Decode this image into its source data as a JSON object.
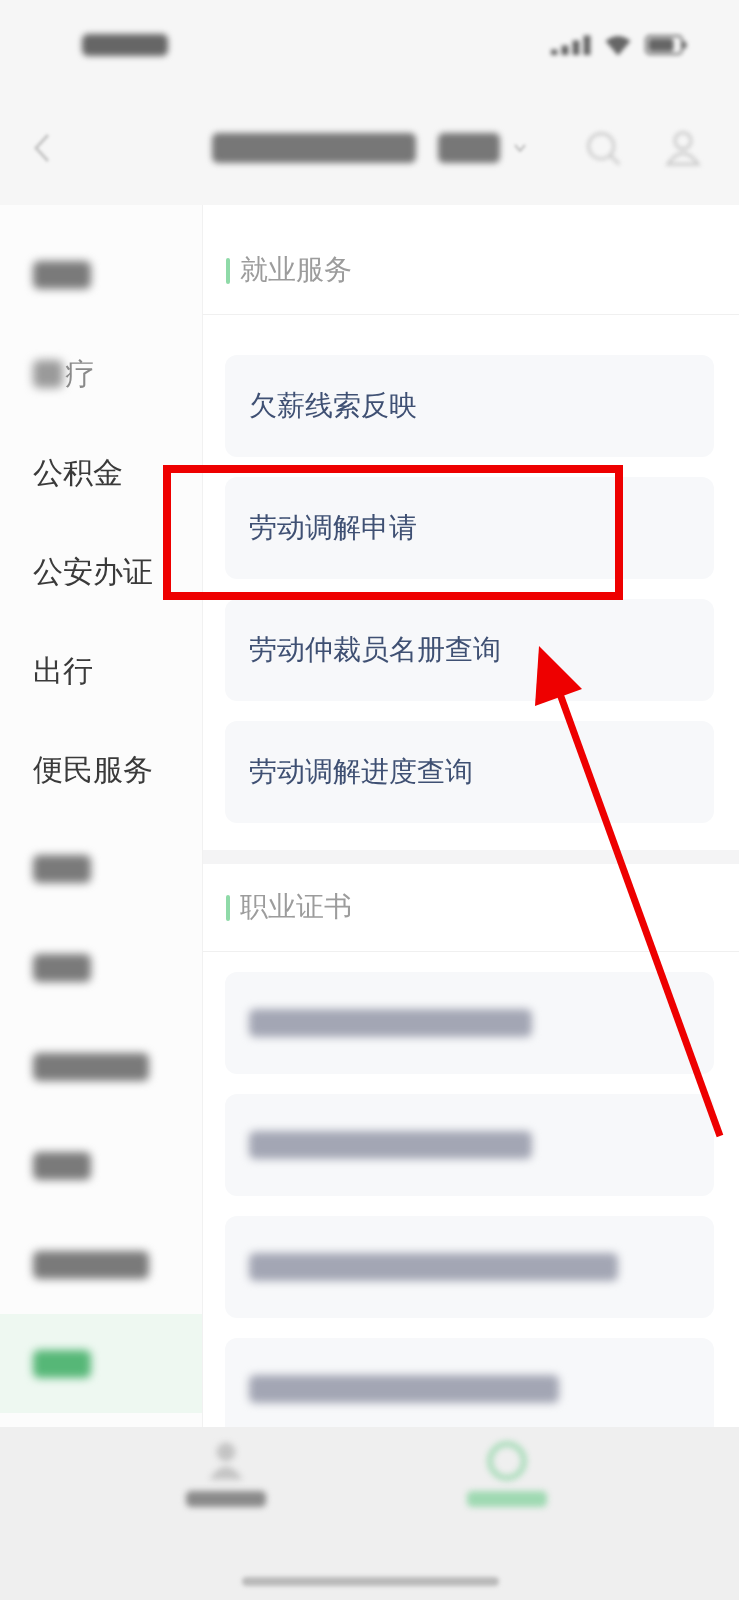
{
  "sidebar": {
    "items": [
      {
        "kind": "blurred",
        "selected": false
      },
      {
        "kind": "partial",
        "label": "疗",
        "selected": false
      },
      {
        "kind": "text",
        "label": "公积金",
        "selected": false
      },
      {
        "kind": "text",
        "label": "公安办证",
        "selected": false
      },
      {
        "kind": "text",
        "label": "出行",
        "selected": false
      },
      {
        "kind": "text",
        "label": "便民服务",
        "selected": false
      },
      {
        "kind": "blurred",
        "selected": false
      },
      {
        "kind": "blurred",
        "selected": false
      },
      {
        "kind": "blurred",
        "selected": false
      },
      {
        "kind": "blurred",
        "selected": false
      },
      {
        "kind": "blurred",
        "selected": false
      },
      {
        "kind": "blurred",
        "selected": true
      }
    ]
  },
  "sections": [
    {
      "title": "就业服务",
      "items": [
        {
          "kind": "text",
          "label": "欠薪线索反映",
          "highlighted": false
        },
        {
          "kind": "text",
          "label": "劳动调解申请",
          "highlighted": true
        },
        {
          "kind": "text",
          "label": "劳动仲裁员名册查询",
          "highlighted": false
        },
        {
          "kind": "text",
          "label": "劳动调解进度查询",
          "highlighted": false
        }
      ]
    },
    {
      "title": "职业证书",
      "items": [
        {
          "kind": "blurred",
          "highlighted": false
        },
        {
          "kind": "blurred",
          "highlighted": false
        },
        {
          "kind": "blurred",
          "highlighted": false
        },
        {
          "kind": "blurred",
          "highlighted": false
        }
      ]
    }
  ],
  "tab_bar": {
    "tabs": [
      {
        "selected": false
      },
      {
        "selected": true
      }
    ]
  }
}
